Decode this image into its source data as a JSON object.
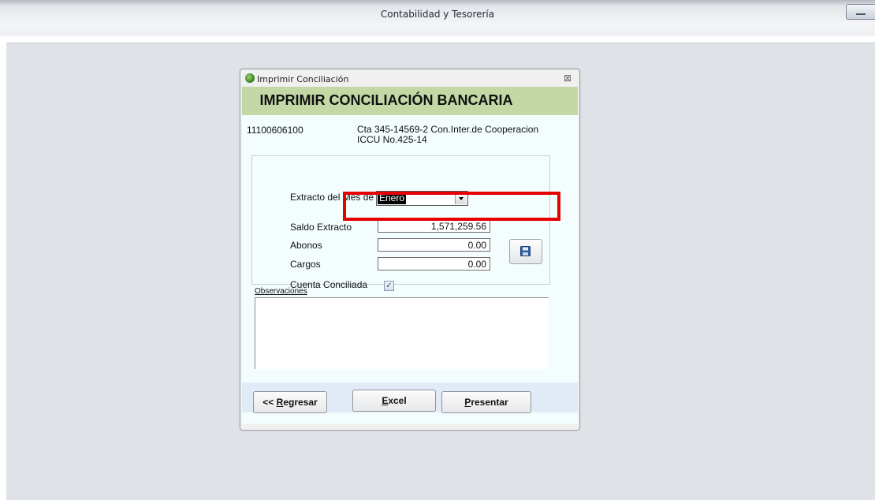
{
  "app": {
    "title": "Contabilidad y Tesorería"
  },
  "dialog": {
    "title": "Imprimir Conciliación",
    "heading": "IMPRIMIR CONCILIACIÓN BANCARIA",
    "account_code": "11100606100",
    "account_desc": "Cta 345-14569-2 Con.Inter.de Cooperacion ICCU No.425-14"
  },
  "form": {
    "month_label": "Extracto del Mes de",
    "month_value": "Enero",
    "saldo_label": "Saldo Extracto",
    "saldo_value": "1,571,259.56",
    "abonos_label": "Abonos",
    "abonos_value": "0.00",
    "cargos_label": "Cargos",
    "cargos_value": "0.00",
    "conciliada_label": "Cuenta Conciliada",
    "conciliada_checked": true,
    "observaciones_label": "Observaciones",
    "observaciones_value": ""
  },
  "buttons": {
    "regresar": {
      "prefix": "<< ",
      "accel": "R",
      "rest": "egresar"
    },
    "excel": {
      "accel": "E",
      "rest": "xcel"
    },
    "presentar": {
      "accel": "P",
      "rest": "resentar"
    }
  },
  "icons": {
    "app": "app-globe-icon",
    "close": "close-icon",
    "save": "floppy-disk-icon",
    "check": "checkmark-icon",
    "dropdown": "chevron-down-icon"
  },
  "colors": {
    "banner": "#c4d8a6",
    "client_bg": "#f4fdfd",
    "button_bar": "#e1ebf7",
    "highlight": "#e60000"
  }
}
